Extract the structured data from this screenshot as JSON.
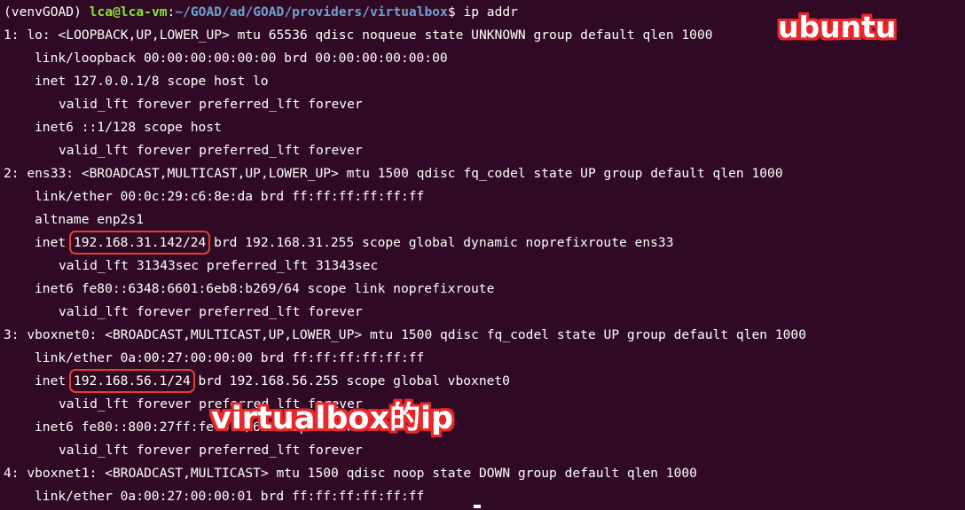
{
  "prompt": {
    "venv": "(venvGOAD) ",
    "user_host": "lca@lca-vm",
    "sep": ":",
    "path": "~/GOAD/ad/GOAD/providers/virtualbox",
    "suffix": "$ ",
    "command": "ip addr"
  },
  "lines": {
    "l1": "1: lo: <LOOPBACK,UP,LOWER_UP> mtu 65536 qdisc noqueue state UNKNOWN group default qlen 1000",
    "l2": "link/loopback 00:00:00:00:00:00 brd 00:00:00:00:00:00",
    "l3": "inet 127.0.0.1/8 scope host lo",
    "l4": "valid_lft forever preferred_lft forever",
    "l5": "inet6 ::1/128 scope host",
    "l6": "valid_lft forever preferred_lft forever",
    "l7": "2: ens33: <BROADCAST,MULTICAST,UP,LOWER_UP> mtu 1500 qdisc fq_codel state UP group default qlen 1000",
    "l8": "link/ether 00:0c:29:c6:8e:da brd ff:ff:ff:ff:ff:ff",
    "l9": "altname enp2s1",
    "l10_pre": "inet ",
    "l10_ip": "192.168.31.142/24",
    "l10_post": " brd 192.168.31.255 scope global dynamic noprefixroute ens33",
    "l11": "valid_lft 31343sec preferred_lft 31343sec",
    "l12": "inet6 fe80::6348:6601:6eb8:b269/64 scope link noprefixroute",
    "l13": "valid_lft forever preferred_lft forever",
    "l14": "3: vboxnet0: <BROADCAST,MULTICAST,UP,LOWER_UP> mtu 1500 qdisc fq_codel state UP group default qlen 1000",
    "l15": "link/ether 0a:00:27:00:00:00 brd ff:ff:ff:ff:ff:ff",
    "l16_pre": "inet ",
    "l16_ip": "192.168.56.1/24",
    "l16_post": " brd 192.168.56.255 scope global vboxnet0",
    "l17": "valid_lft forever preferred_lft forever",
    "l18": "inet6 fe80::800:27ff:fe00:0/64 scope link",
    "l19": "valid_lft forever preferred_lft forever",
    "l20": "4: vboxnet1: <BROADCAST,MULTICAST> mtu 1500 qdisc noop state DOWN group default qlen 1000",
    "l21": "link/ether 0a:00:27:00:00:01 brd ff:ff:ff:ff:ff:ff"
  },
  "annotations": {
    "os_label": "ubuntu",
    "vbox_label": "virtualbox的ip"
  },
  "colors": {
    "background": "#300a24",
    "prompt_user": "#8ae234",
    "prompt_path": "#729fcf",
    "highlight_box": "#e53a3a",
    "annotation_outline": "#e8282b"
  }
}
